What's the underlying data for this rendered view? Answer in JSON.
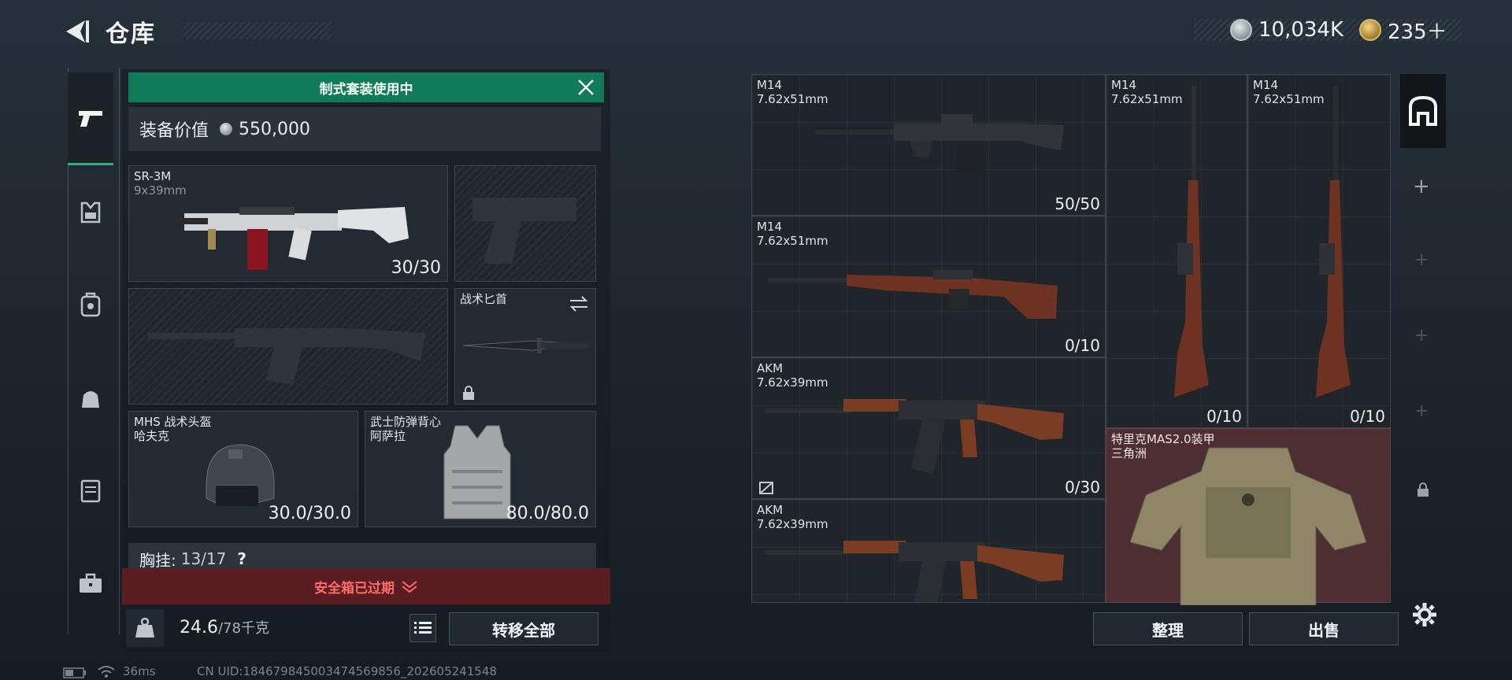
{
  "header": {
    "title": "仓库",
    "currency_primary": "10,034K",
    "currency_secondary": "235＋"
  },
  "rail": {
    "items": [
      "weapons-icon",
      "armor-icon",
      "backpack-icon",
      "bag-icon",
      "case-icon",
      "toolbox-icon"
    ]
  },
  "loadout": {
    "banner": "制式套装使用中",
    "value_label": "装备价值",
    "value": "550,000",
    "primary": {
      "name": "SR-3M",
      "caliber": "9x39mm",
      "count": "30/30"
    },
    "melee": {
      "name": "战术匕首"
    },
    "helmet": {
      "name": "MHS 战术头盔",
      "map": "哈夫克",
      "durability": "30.0/30.0"
    },
    "vest": {
      "name": "武士防弹背心",
      "map": "阿萨拉",
      "durability": "80.0/80.0"
    },
    "chest_label": "胸挂:",
    "chest_value": "13/17",
    "chest_help": "?",
    "safebox_status": "安全箱已过期",
    "weight": "24.6",
    "weight_max": "/78千克",
    "transfer_all": "转移全部"
  },
  "storage": {
    "items": [
      {
        "name": "M14",
        "caliber": "7.62x51mm",
        "count": "50/50"
      },
      {
        "name": "M14",
        "caliber": "7.62x51mm",
        "count": "0/10"
      },
      {
        "name": "AKM",
        "caliber": "7.62x39mm",
        "count": "0/30"
      },
      {
        "name": "AKM",
        "caliber": "7.62x39mm",
        "count": ""
      },
      {
        "name": "M14",
        "caliber": "7.62x51mm",
        "count": "0/10"
      },
      {
        "name": "M14",
        "caliber": "7.62x51mm",
        "count": "0/10"
      }
    ],
    "armor": {
      "name": "特里克MAS2.0装甲",
      "map": "三角洲"
    },
    "sort_label": "整理",
    "sell_label": "出售"
  },
  "status_bar": {
    "ping": "36ms",
    "uid": "CN UID:184679845003474569856_202605241548"
  },
  "colors": {
    "accent": "#117a58",
    "danger": "#5a1e22",
    "armor_bg": "#4d2f33"
  }
}
